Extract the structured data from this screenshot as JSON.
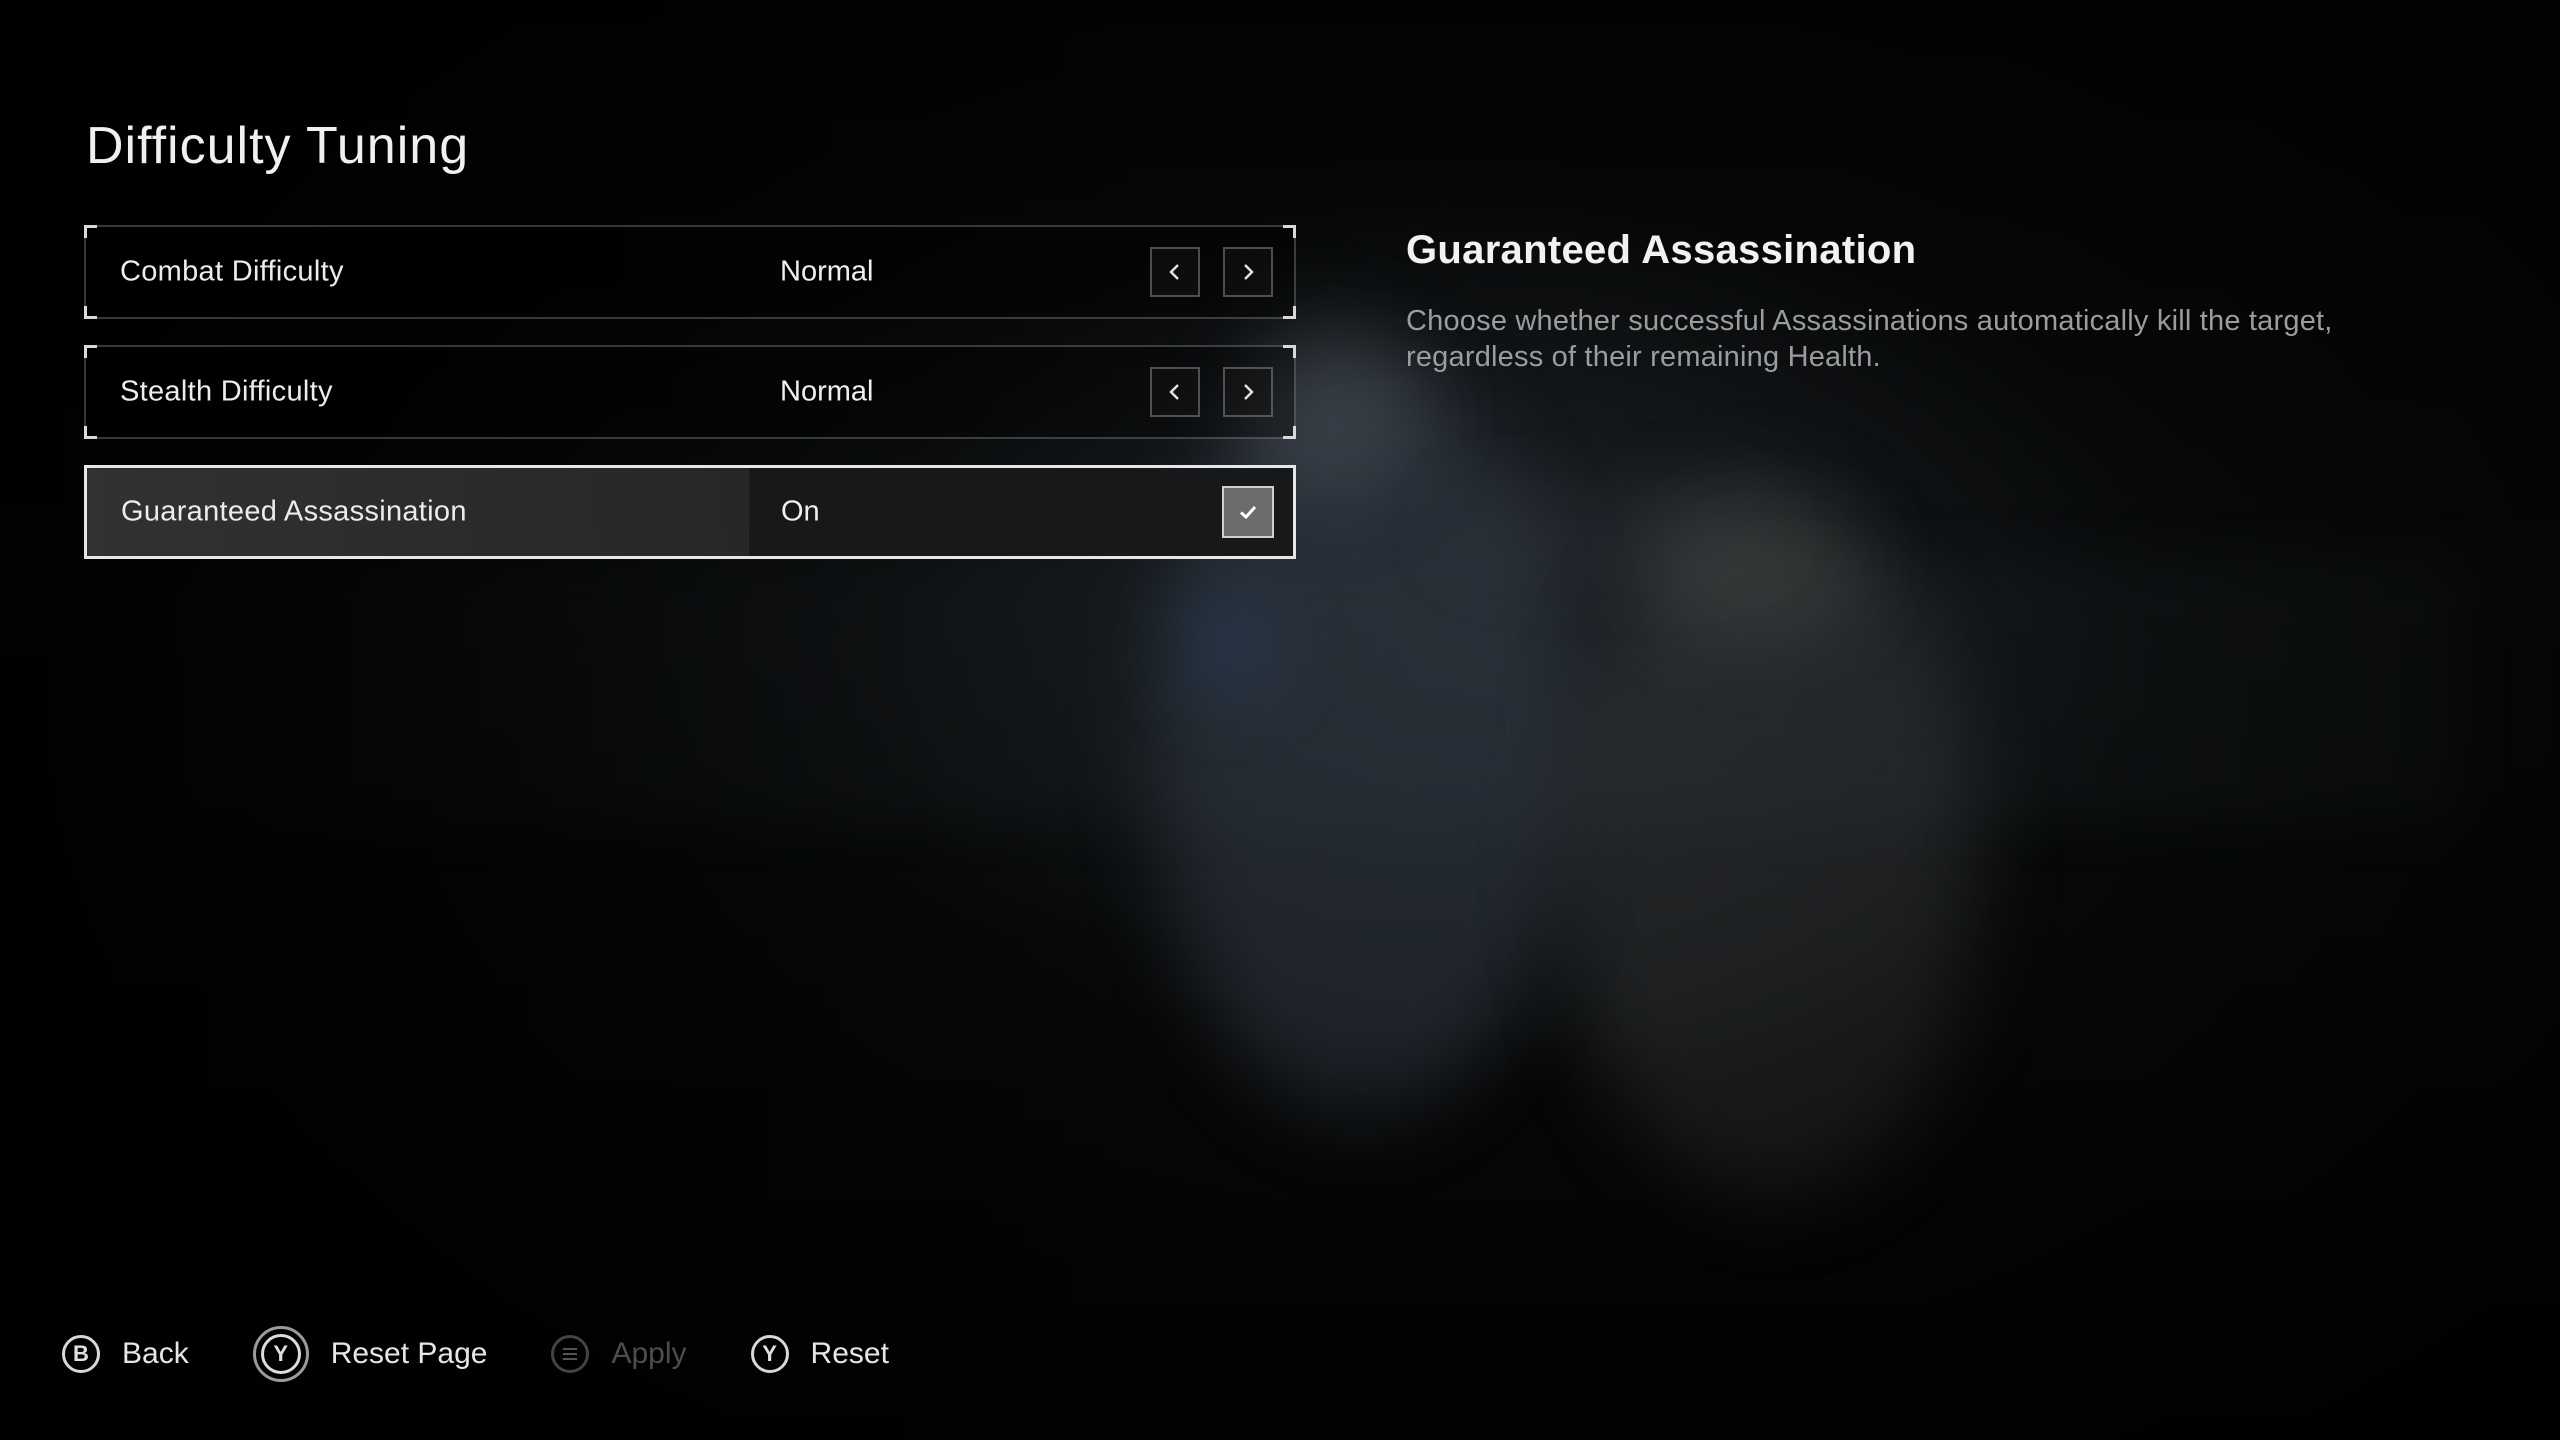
{
  "page": {
    "title": "Difficulty Tuning"
  },
  "settings": [
    {
      "label": "Combat Difficulty",
      "value": "Normal",
      "control": "arrows"
    },
    {
      "label": "Stealth Difficulty",
      "value": "Normal",
      "control": "arrows"
    },
    {
      "label": "Guaranteed Assassination",
      "value": "On",
      "control": "checkbox",
      "checked": true,
      "selected": true
    }
  ],
  "description": {
    "title": "Guaranteed Assassination",
    "body": "Choose whether successful Assassinations automatically kill the target, regardless of their remaining Health."
  },
  "footer": {
    "back": {
      "icon": "B",
      "label": "Back"
    },
    "reset_page": {
      "icon": "Y",
      "label": "Reset Page"
    },
    "apply": {
      "icon": "menu-icon",
      "label": "Apply",
      "disabled": true
    },
    "reset": {
      "icon": "Y",
      "label": "Reset"
    }
  },
  "icons": {
    "arrow_left": "chevron-left-icon",
    "arrow_right": "chevron-right-icon",
    "checkbox": "check-icon"
  },
  "colors": {
    "background": "#040505",
    "text": "#e9eaea",
    "description_text": "#9a9c9e",
    "checkbox_fill": "#6c6c6c",
    "disabled": "#4c4d4e"
  }
}
